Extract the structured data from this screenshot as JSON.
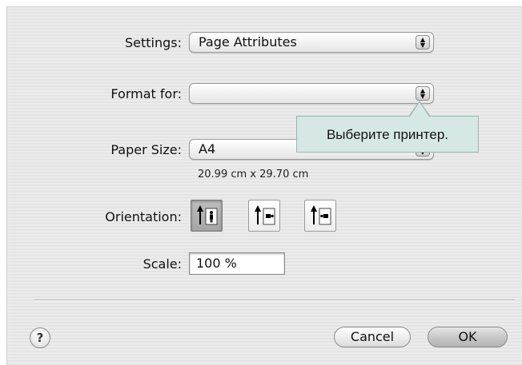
{
  "settings": {
    "label": "Settings:",
    "value": "Page Attributes"
  },
  "format_for": {
    "label": "Format for:",
    "value": ""
  },
  "paper_size": {
    "label": "Paper Size:",
    "value": "A4",
    "dimensions": "20.99 cm x 29.70 cm"
  },
  "orientation": {
    "label": "Orientation:",
    "options": [
      "portrait",
      "landscape-left",
      "landscape-right"
    ],
    "selected": "portrait"
  },
  "scale": {
    "label": "Scale:",
    "value": "100 %"
  },
  "tooltip": {
    "text": "Выберите принтер."
  },
  "buttons": {
    "help": "?",
    "cancel": "Cancel",
    "ok": "OK"
  },
  "icons": {
    "popup_arrows": "up-down-chevrons-icon",
    "help": "question-mark-icon"
  }
}
